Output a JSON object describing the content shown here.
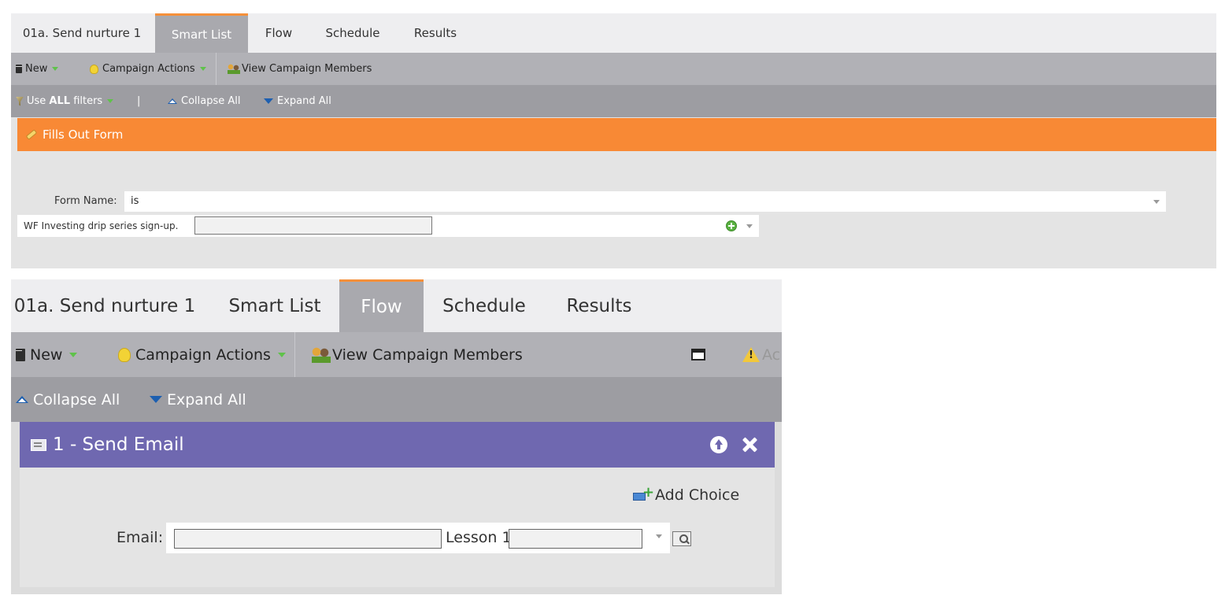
{
  "smart_list_view": {
    "tabs": [
      {
        "label": "01a. Send nurture 1"
      },
      {
        "label": "Smart List",
        "active": true
      },
      {
        "label": "Flow"
      },
      {
        "label": "Schedule"
      },
      {
        "label": "Results"
      }
    ],
    "toolbar": {
      "new_label": "New",
      "campaign_actions_label": "Campaign Actions",
      "view_members_label": "View Campaign Members"
    },
    "filter_bar": {
      "use_prefix": "Use ",
      "use_bold": "ALL",
      "use_suffix": " filters",
      "separator": "|",
      "collapse_label": "Collapse All",
      "expand_label": "Expand All"
    },
    "filter": {
      "title": "Fills Out Form",
      "form_name_label": "Form Name:",
      "operator": "is",
      "value_text": "WF Investing drip series sign-up."
    },
    "colors": {
      "header": "#f88935",
      "active_tab_accent": "#f5903a"
    }
  },
  "flow_view": {
    "tabs": [
      {
        "label": "01a. Send nurture 1"
      },
      {
        "label": "Smart List"
      },
      {
        "label": "Flow",
        "active": true
      },
      {
        "label": "Schedule"
      },
      {
        "label": "Results"
      }
    ],
    "toolbar": {
      "new_label": "New",
      "campaign_actions_label": "Campaign Actions",
      "view_members_label": "View Campaign Members",
      "truncated_label": "Ac"
    },
    "collapse_bar": {
      "collapse_label": "Collapse All",
      "expand_label": "Expand All"
    },
    "step": {
      "title": "1 - Send Email",
      "add_choice_label": "Add Choice",
      "email_label": "Email:",
      "email_value_text": "Lesson 1"
    },
    "colors": {
      "header": "#6f68b0"
    }
  }
}
